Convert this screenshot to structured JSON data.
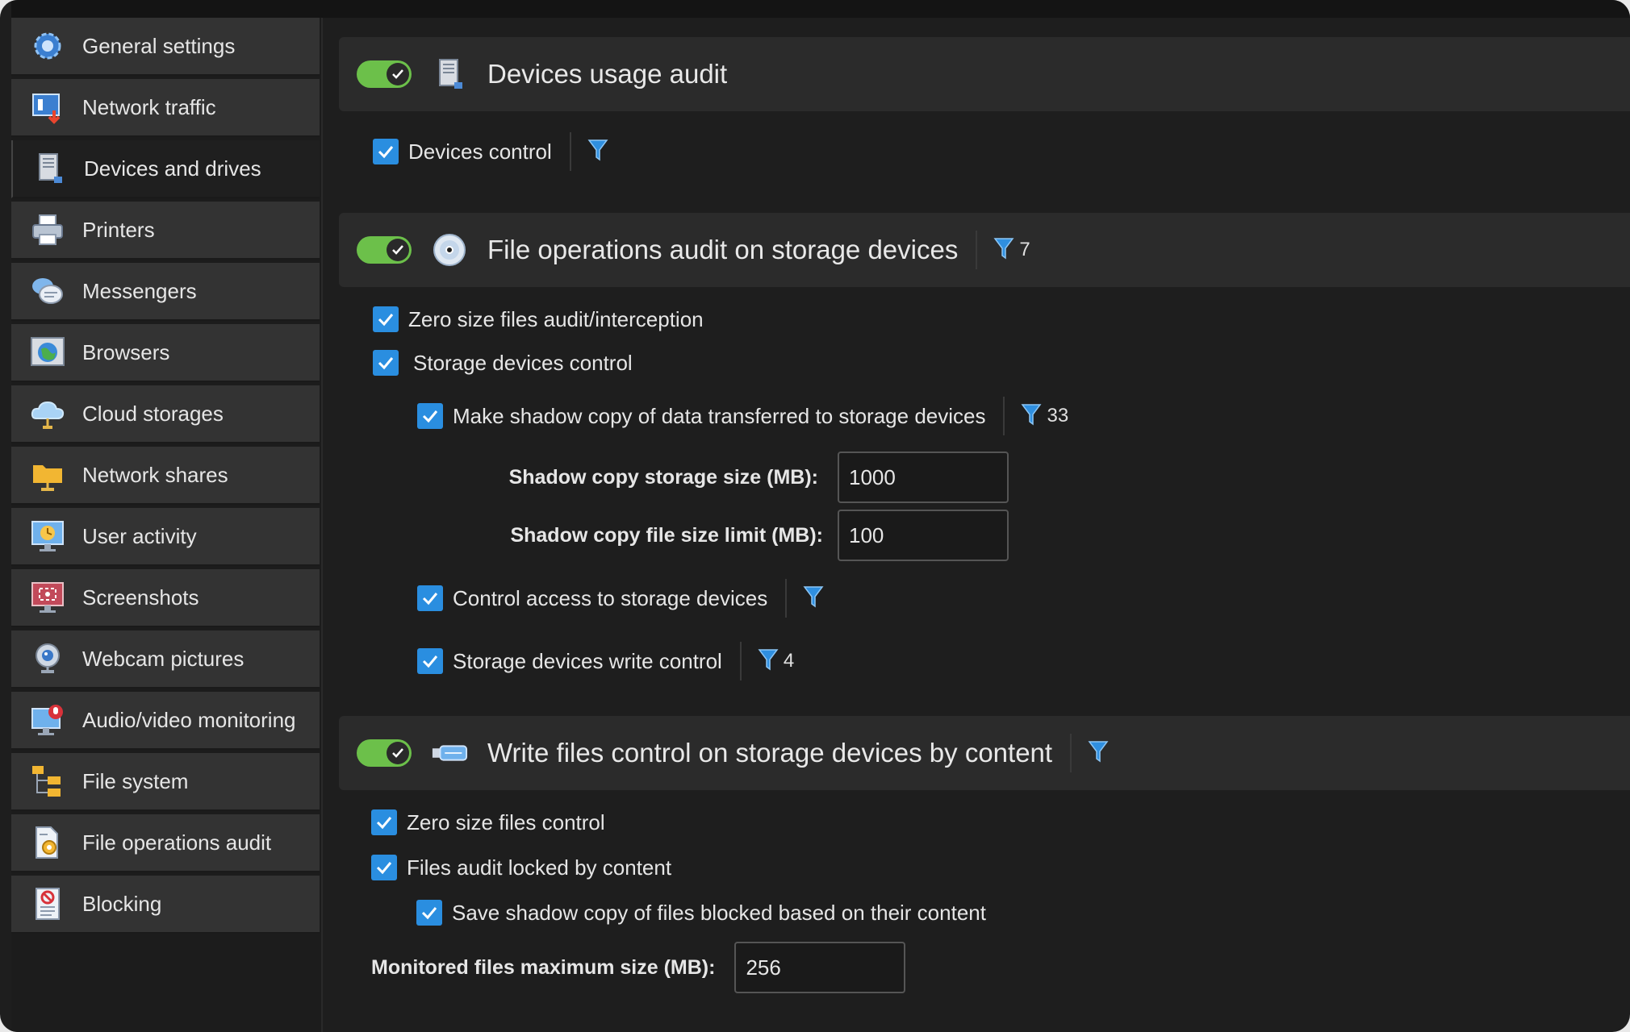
{
  "sidebar": {
    "items": [
      {
        "label": "General settings",
        "icon": "gear-icon"
      },
      {
        "label": "Network traffic",
        "icon": "network-traffic-icon"
      },
      {
        "label": "Devices and drives",
        "icon": "computer-tower-icon"
      },
      {
        "label": "Printers",
        "icon": "printer-icon"
      },
      {
        "label": "Messengers",
        "icon": "chat-bubbles-icon"
      },
      {
        "label": "Browsers",
        "icon": "globe-icon"
      },
      {
        "label": "Cloud storages",
        "icon": "cloud-icon"
      },
      {
        "label": "Network shares",
        "icon": "shared-folder-icon"
      },
      {
        "label": "User activity",
        "icon": "clock-monitor-icon"
      },
      {
        "label": "Screenshots",
        "icon": "screenshot-icon"
      },
      {
        "label": "Webcam pictures",
        "icon": "webcam-icon"
      },
      {
        "label": "Audio/video monitoring",
        "icon": "audio-video-icon"
      },
      {
        "label": "File system",
        "icon": "folder-tree-icon"
      },
      {
        "label": "File operations audit",
        "icon": "file-audit-icon"
      },
      {
        "label": "Blocking",
        "icon": "blocking-document-icon"
      }
    ],
    "selected": "Devices and drives"
  },
  "sections": {
    "devices_usage": {
      "title": "Devices usage audit",
      "enabled": true,
      "options": {
        "devices_control": {
          "label": "Devices control",
          "checked": true
        }
      }
    },
    "file_ops": {
      "title": "File operations audit on storage devices",
      "enabled": true,
      "filter_count": "7",
      "options": {
        "zero_size": {
          "label": "Zero size files audit/interception",
          "checked": true
        },
        "storage_control": {
          "label": "Storage devices control",
          "checked": true
        },
        "shadow_copy": {
          "label": "Make shadow copy of data transferred to storage devices",
          "checked": true,
          "filter_count": "33"
        },
        "control_access": {
          "label": "Control access to storage devices",
          "checked": true
        },
        "write_control": {
          "label": "Storage devices write control",
          "checked": true,
          "filter_count": "4"
        }
      },
      "fields": {
        "storage_size": {
          "label": "Shadow copy storage size (MB):",
          "value": "1000"
        },
        "file_size_limit": {
          "label": "Shadow copy file size limit (MB):",
          "value": "100"
        }
      }
    },
    "write_content": {
      "title": "Write files control on storage devices by content",
      "enabled": true,
      "options": {
        "zero_size": {
          "label": "Zero size files control",
          "checked": true
        },
        "audit_locked": {
          "label": "Files audit locked by content",
          "checked": true
        },
        "save_shadow": {
          "label": "Save shadow copy of files blocked based on their content",
          "checked": true
        }
      },
      "fields": {
        "max_size": {
          "label": "Monitored files maximum size (MB):",
          "value": "256"
        }
      }
    }
  },
  "colors": {
    "toggle_on": "#6cc04a",
    "checkbox": "#2a8ee0",
    "filter": "#2f8fe0"
  }
}
